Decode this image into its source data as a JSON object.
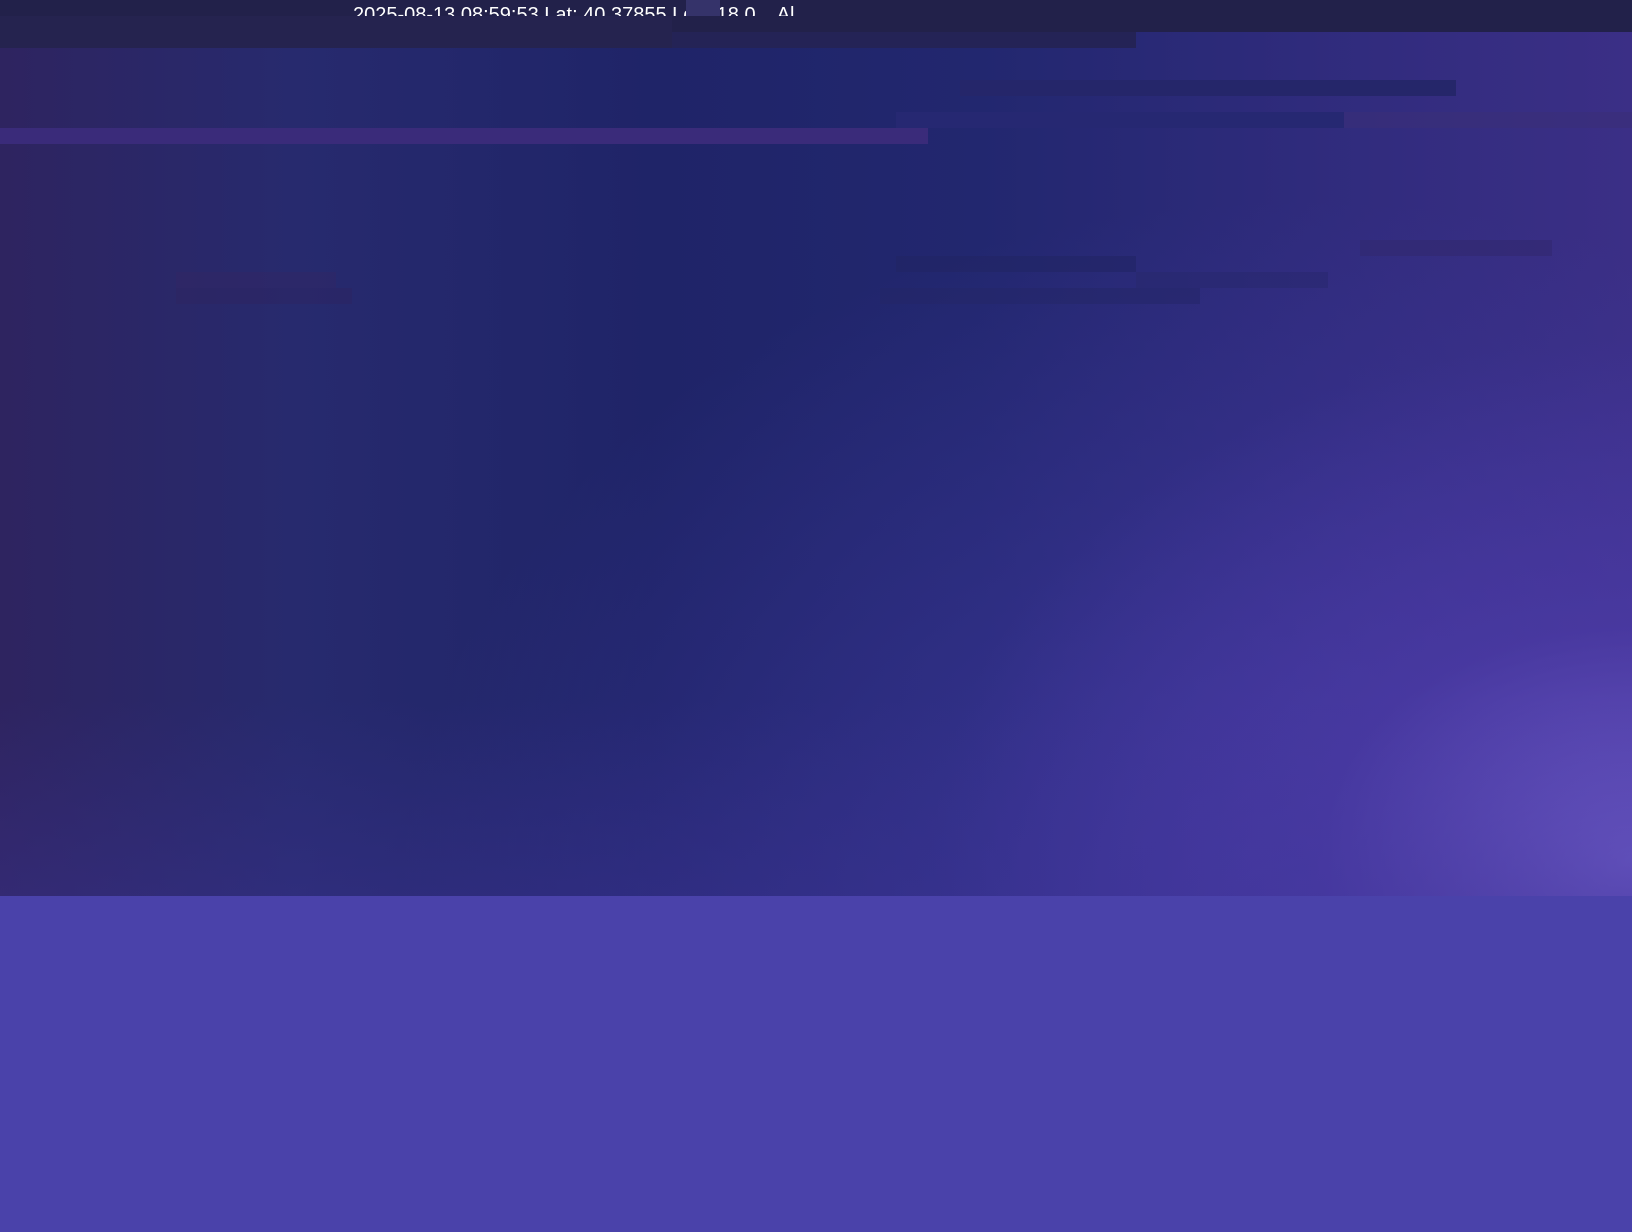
{
  "overlay": {
    "timestamp_text": "2025-08-13 08:59:53 Lat: 40.37855  Lon: 18.0...  Al..."
  },
  "colors": {
    "page_background": "#4a42aa",
    "top_bar": "#22214a",
    "watermark_text": "#ffffff"
  }
}
